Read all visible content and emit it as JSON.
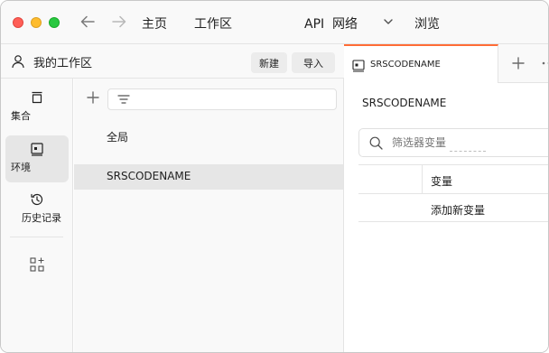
{
  "titlebar": {
    "home": "主页",
    "workspaces": "工作区",
    "api_network": "API  网络",
    "explore": "浏览"
  },
  "workspace": {
    "title": "我的工作区",
    "new_label": "新建",
    "import_label": "导入"
  },
  "sidebar": {
    "items": [
      {
        "label": "集合",
        "icon": "collections-icon"
      },
      {
        "label": "环境",
        "icon": "environments-icon",
        "active": true
      },
      {
        "label": "历史记录",
        "icon": "history-icon"
      }
    ],
    "more_icon": "apps-grid-icon"
  },
  "environments": {
    "items": [
      {
        "label": "全局",
        "selected": false
      },
      {
        "label": "SRSCODENAME",
        "selected": true
      }
    ]
  },
  "tab": {
    "label": "SRSCODENAME",
    "icon": "environment-tab-icon"
  },
  "main": {
    "env_name": "SRSCODENAME",
    "filter_placeholder": "筛选器变量",
    "table": {
      "header": "变量",
      "add_row": "添加新变量"
    }
  },
  "colors": {
    "accent": "#ff6c37",
    "sidebar_bg": "#f9f9f9",
    "selected_bg": "#e6e6e6"
  }
}
